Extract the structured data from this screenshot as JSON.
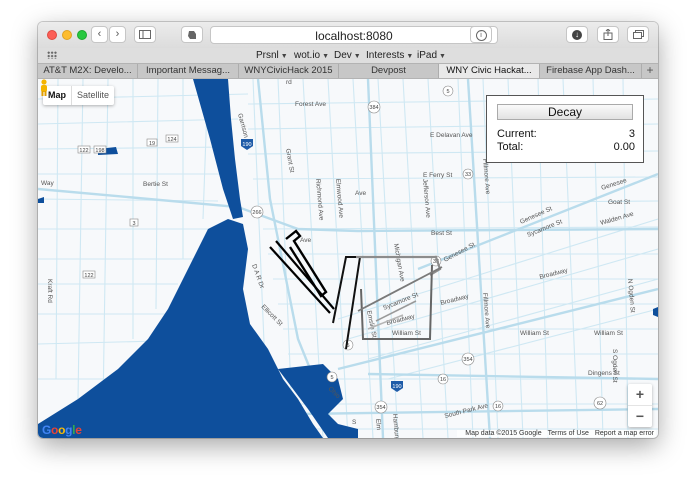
{
  "browser": {
    "url": "localhost:8080",
    "bookmarks": [
      {
        "label": "Prsnl",
        "has_menu": true
      },
      {
        "label": "wot.io",
        "has_menu": true
      },
      {
        "label": "Dev",
        "has_menu": true
      },
      {
        "label": "Interests",
        "has_menu": true
      },
      {
        "label": "iPad",
        "has_menu": true
      }
    ],
    "tabs": [
      {
        "label": "AT&T M2X: Develo...",
        "active": false
      },
      {
        "label": "Important Messag...",
        "active": false
      },
      {
        "label": "WNYCivicHack 2015",
        "active": false
      },
      {
        "label": "Devpost",
        "active": false
      },
      {
        "label": "WNY Civic Hackat...",
        "active": true
      },
      {
        "label": "Firebase App Dash...",
        "active": false
      }
    ],
    "new_tab": "+"
  },
  "map": {
    "map_type": {
      "map": "Map",
      "satellite": "Satellite",
      "selected": "Map"
    },
    "labels": {
      "forest_ave": "Forest Ave",
      "delavan": "E Delavan Ave",
      "ferry": "E Ferry St",
      "best": "Best St",
      "genesee": "Genesee St",
      "genesee2": "Genesee St",
      "sycamore": "Sycamore St",
      "sycamore2": "Sycamore St",
      "walden": "Walden Ave",
      "goat": "Goat St",
      "broadway": "Broadway",
      "broadway2": "Broadway",
      "broadway3": "Broadway",
      "william": "William St",
      "william2": "William St",
      "william3": "William St",
      "dingens": "Dingens St",
      "s_park": "South Park Ave",
      "bertie": "Bertie St",
      "kraft": "Kraft Rd",
      "grant": "Grant St",
      "richmond": "Richmond Ave",
      "elmwood": "Elmwood Ave",
      "jefferson": "Jefferson Ave",
      "fillmore": "Fillmore Ave",
      "fillmore2": "Fillmore Ave",
      "ogden": "N Ogden St",
      "michigan": "Michigan Ave",
      "sogden": "S Ogden St",
      "emslie": "Emslie St",
      "way": "Way",
      "garrison": "Garrison Rd",
      "dr": "D A R Dr",
      "rd": "rd",
      "ave": "Ave",
      "genesee_e": "Genesee",
      "ellicott": "Ellicott St",
      "ohio": "Ohio",
      "ave2": "Ave",
      "s_pl": "S",
      "elm": "Elm",
      "hamburg": "Hamburg"
    },
    "shields": [
      "384",
      "5",
      "190",
      "19",
      "124",
      "122",
      "198",
      "266",
      "3",
      "33",
      "33",
      "354",
      "5",
      "190",
      "16",
      "16",
      "62",
      "5",
      "354",
      "122"
    ],
    "decay_panel": {
      "button_label": "Decay",
      "current_label": "Current:",
      "current_value": "3",
      "total_label": "Total:",
      "total_value": "0.00"
    },
    "zoom_in": "+",
    "zoom_out": "−",
    "attribution": {
      "data": "Map data ©2015 Google",
      "terms": "Terms of Use",
      "report": "Report a map error"
    },
    "google_logo": "Google"
  }
}
